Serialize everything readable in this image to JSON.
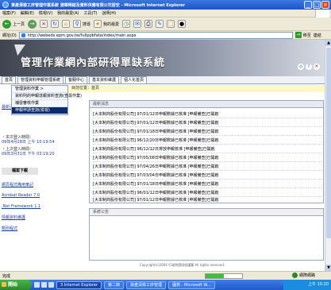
{
  "window": {
    "title": "資產清檢工序管理作業系統 澳華稀結及資料供應有限公司居空 - Microsoft Internet Explorer",
    "buttons": [
      "_",
      "□",
      "×"
    ]
  },
  "menu": [
    "檔案(F)",
    "編輯(E)",
    "檢視(V)",
    "我的最愛(A)",
    "工具(T)",
    "說明(H)"
  ],
  "toolbar": {
    "back_label": "上一頁",
    "search_label": "搜尋",
    "favorites_label": "我的最愛"
  },
  "address": {
    "label": "網址(D)",
    "url": "http://webeds.epm.gov.tw/fullppbfata/index/main.aspx",
    "go_label": "移至",
    "links_label": "連結"
  },
  "banner": {
    "title": "管理作業網內部研得單缺系統"
  },
  "tabs": [
    "首頁",
    "管理資料申報管理系統",
    "客服中心",
    "基本資料維護",
    "個人化首頁"
  ],
  "submenu": [
    {
      "label": "管理資料作業 >",
      "highlight": false
    },
    {
      "label": "資料則的申報達報資料查詢(查尋作業)",
      "highlight": false
    },
    {
      "label": "補發審核作業",
      "highlight": false
    },
    {
      "label": "申報申請查詢(檢視)",
      "highlight": true
    }
  ],
  "breadcrumb": "目前位置：首頁",
  "left": {
    "note1": "最新消息",
    "login1_label": "・本次登入時間：",
    "login1_time": "09年4月28日 上午 10:19:54",
    "login2_label": "・上次登入時間：",
    "login2_time": "09年3月31日 下午 03:19:20",
    "download_head": "檔案下載",
    "links": [
      "網頁程式備用筆記",
      "Acrobat Reader 7.0",
      ".Net Framework 1.1",
      "情報資料維護",
      "類別程式"
    ]
  },
  "news_head": "最新消息",
  "news": [
    "[大本制商股份有限公司] 97/01/12日申報數據已核准 [申報備查]已開啟",
    "[大本制商股份有限公司] 97/01/12日申報數據已核准 [申報備查]已開啟",
    "[大本制商股份有限公司] 97/01/18日申報數據已核准 [申報備查]已開啟",
    "[大本制商股份有限公司] 96/12/20日申報數據已核准 [申報備查]已開啟",
    "[大本制商股份有限公司] 96/12/12日排放申報核准 [申報備查]已開啟",
    "[大本制商股份有限公司] 97/05/08日申報數據已核准 [申報備查]已開啟",
    "[大本制商股份有限公司] 97/04/26日申報數據已核准 [申報備查]已開啟",
    "[大本制商股份有限公司] 97/03/04日申報數據已核准 [申報備查]已開啟",
    "[大本制商股份有限公司] 97/01/18日申報數據已核准 [申報備查]已開啟",
    "[大本制商股份有限公司] 96/01/12日申報數據已核准 [申報備查]已開啟",
    "[大本制商股份有限公司] 97/01/12日申報數據已核准 [申報備查]已開啟"
  ],
  "panel2_head": "系統公告",
  "footer": "Copyright(c)2004 行政院環境保護署 All rights reserved.",
  "status": {
    "text": "完成",
    "zone": "網際網路",
    "progress": 0.5
  },
  "taskbar": {
    "start": "開始",
    "tasks": [
      "3 Internet Explorer",
      "第二節",
      "資產清檢工序管理",
      "圖表 - Microsoft W..."
    ],
    "time": "上午 10:20"
  },
  "colors": {
    "accent": "#1f55c8",
    "highlight": "#0b2a6b",
    "crumb_bg": "#fff8c4"
  }
}
